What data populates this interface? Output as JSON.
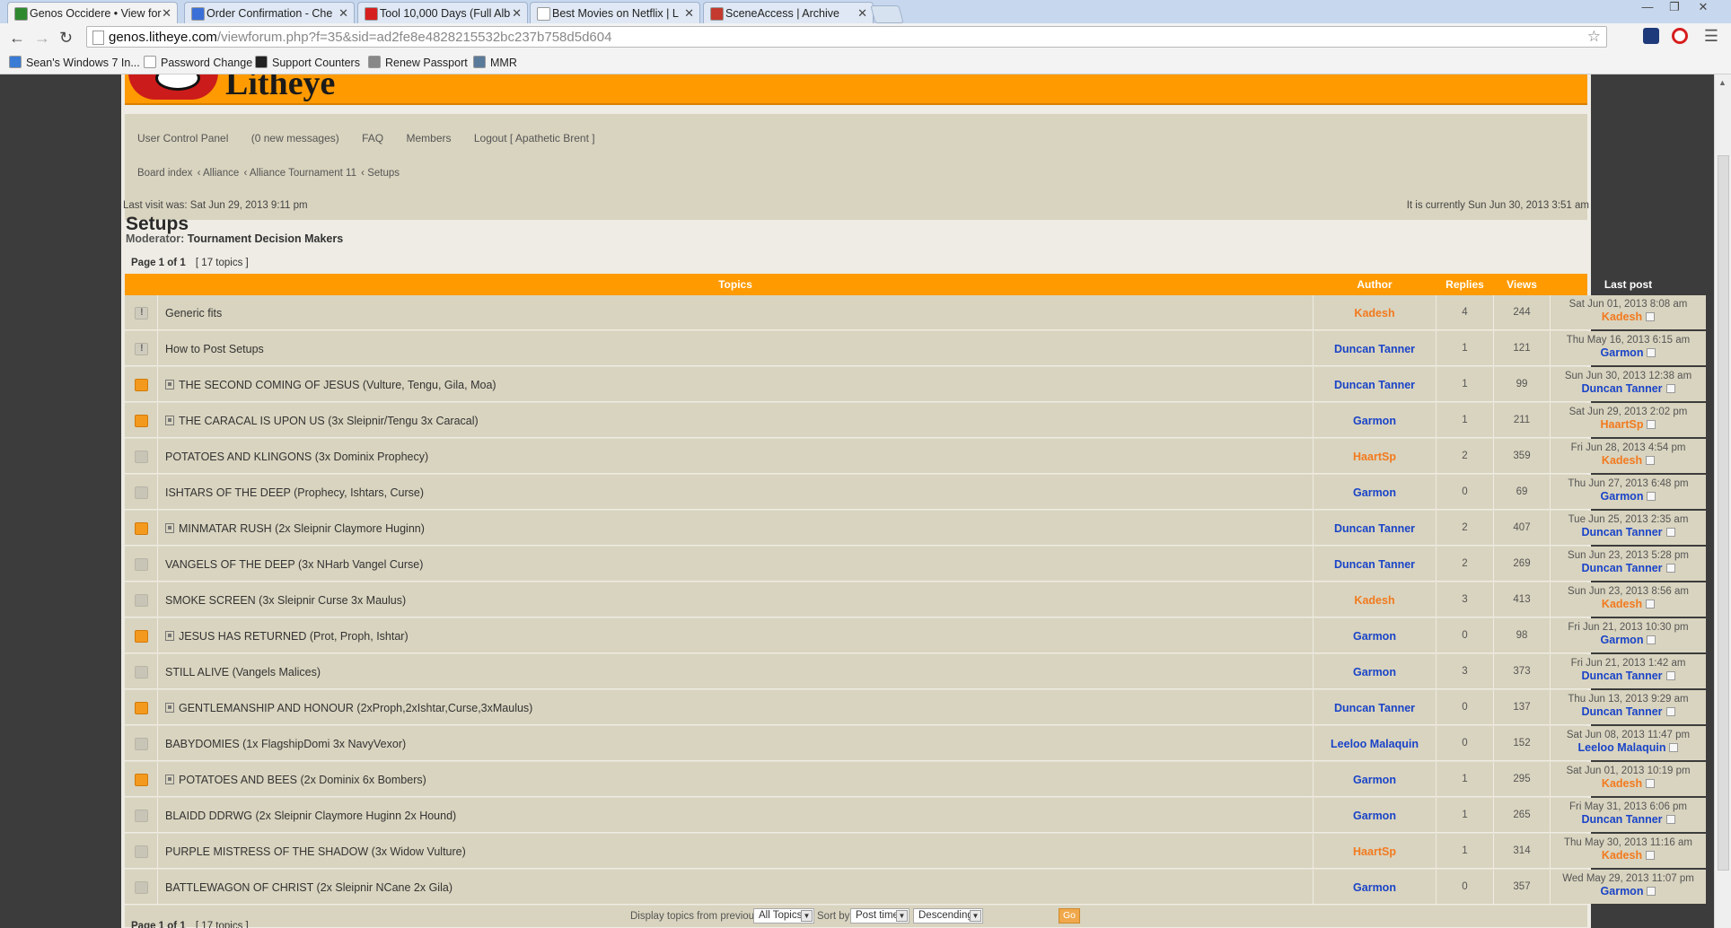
{
  "browser": {
    "tabs": [
      {
        "title": "Genos Occidere • View for",
        "color": "#2f8a2f",
        "active": true
      },
      {
        "title": "Order Confirmation - Che",
        "color": "#3a6fd8",
        "active": false
      },
      {
        "title": "Tool 10,000 Days (Full Alb",
        "color": "#d61f1f",
        "active": false
      },
      {
        "title": "Best Movies on Netflix | L",
        "color": "#ffffff",
        "active": false
      },
      {
        "title": "SceneAccess | Archive",
        "color": "#c43a2e",
        "active": false
      }
    ],
    "url_host": "genos.litheye.com",
    "url_path": "/viewforum.php?f=35&sid=ad2fe8e4828215532bc237b758d5d604",
    "bookmarks": [
      {
        "label": "Sean's Windows 7 In...",
        "color": "#3a7bd5"
      },
      {
        "label": "Password Change",
        "color": "#ffffff"
      },
      {
        "label": "Support Counters",
        "color": "#222222"
      },
      {
        "label": "Renew Passport",
        "color": "#888888"
      },
      {
        "label": "MMR",
        "color": "#5a7a9a"
      }
    ]
  },
  "site": {
    "logo_text": "Litheye",
    "toplinks": [
      "User Control Panel",
      "(0 new messages)",
      "FAQ",
      "Members",
      "Logout [ Apathetic Brent ]"
    ],
    "breadcrumbs": [
      "Board index",
      "Alliance",
      "Alliance Tournament 11",
      "Setups"
    ],
    "last_visit": "Last visit was: Sat Jun 29, 2013 9:11 pm",
    "currently": "It is currently Sun Jun 30, 2013 3:51 am"
  },
  "forum": {
    "title": "Setups",
    "moderator_label": "Moderator:",
    "moderator": "Tournament Decision Makers",
    "page": "Page 1 of 1",
    "topic_count": "[ 17 topics ]",
    "headers": {
      "topics": "Topics",
      "author": "Author",
      "replies": "Replies",
      "views": "Views",
      "last_post": "Last post"
    },
    "topics": [
      {
        "title": "Generic fits",
        "icon": "sticky",
        "posted": false,
        "author": "Kadesh",
        "author_color": "orange",
        "replies": "4",
        "views": "244",
        "last_date": "Sat Jun 01, 2013 8:08 am",
        "last_author": "Kadesh",
        "last_color": "orange"
      },
      {
        "title": "How to Post Setups",
        "icon": "sticky",
        "posted": false,
        "author": "Duncan Tanner",
        "author_color": "blue",
        "replies": "1",
        "views": "121",
        "last_date": "Thu May 16, 2013 6:15 am",
        "last_author": "Garmon",
        "last_color": "blue"
      },
      {
        "title": "THE SECOND COMING OF JESUS (Vulture, Tengu, Gila, Moa)",
        "icon": "hot",
        "posted": true,
        "author": "Duncan Tanner",
        "author_color": "blue",
        "replies": "1",
        "views": "99",
        "last_date": "Sun Jun 30, 2013 12:38 am",
        "last_author": "Duncan Tanner",
        "last_color": "blue"
      },
      {
        "title": "THE CARACAL IS UPON US (3x Sleipnir/Tengu 3x Caracal)",
        "icon": "hot",
        "posted": true,
        "author": "Garmon",
        "author_color": "blue",
        "replies": "1",
        "views": "211",
        "last_date": "Sat Jun 29, 2013 2:02 pm",
        "last_author": "HaartSp",
        "last_color": "orange"
      },
      {
        "title": "POTATOES AND KLINGONS (3x Dominix Prophecy)",
        "icon": "normal",
        "posted": false,
        "author": "HaartSp",
        "author_color": "orange",
        "replies": "2",
        "views": "359",
        "last_date": "Fri Jun 28, 2013 4:54 pm",
        "last_author": "Kadesh",
        "last_color": "orange"
      },
      {
        "title": "ISHTARS OF THE DEEP (Prophecy, Ishtars, Curse)",
        "icon": "normal",
        "posted": false,
        "author": "Garmon",
        "author_color": "blue",
        "replies": "0",
        "views": "69",
        "last_date": "Thu Jun 27, 2013 6:48 pm",
        "last_author": "Garmon",
        "last_color": "blue"
      },
      {
        "title": "MINMATAR RUSH (2x Sleipnir Claymore Huginn)",
        "icon": "hot",
        "posted": true,
        "author": "Duncan Tanner",
        "author_color": "blue",
        "replies": "2",
        "views": "407",
        "last_date": "Tue Jun 25, 2013 2:35 am",
        "last_author": "Duncan Tanner",
        "last_color": "blue"
      },
      {
        "title": "VANGELS OF THE DEEP (3x NHarb Vangel Curse)",
        "icon": "normal",
        "posted": false,
        "author": "Duncan Tanner",
        "author_color": "blue",
        "replies": "2",
        "views": "269",
        "last_date": "Sun Jun 23, 2013 5:28 pm",
        "last_author": "Duncan Tanner",
        "last_color": "blue"
      },
      {
        "title": "SMOKE SCREEN (3x Sleipnir Curse 3x Maulus)",
        "icon": "normal",
        "posted": false,
        "author": "Kadesh",
        "author_color": "orange",
        "replies": "3",
        "views": "413",
        "last_date": "Sun Jun 23, 2013 8:56 am",
        "last_author": "Kadesh",
        "last_color": "orange"
      },
      {
        "title": "JESUS HAS RETURNED (Prot, Proph, Ishtar)",
        "icon": "hot",
        "posted": true,
        "author": "Garmon",
        "author_color": "blue",
        "replies": "0",
        "views": "98",
        "last_date": "Fri Jun 21, 2013 10:30 pm",
        "last_author": "Garmon",
        "last_color": "blue"
      },
      {
        "title": "STILL ALIVE (Vangels Malices)",
        "icon": "normal",
        "posted": false,
        "author": "Garmon",
        "author_color": "blue",
        "replies": "3",
        "views": "373",
        "last_date": "Fri Jun 21, 2013 1:42 am",
        "last_author": "Duncan Tanner",
        "last_color": "blue"
      },
      {
        "title": "GENTLEMANSHIP AND HONOUR (2xProph,2xIshtar,Curse,3xMaulus)",
        "icon": "hot",
        "posted": true,
        "author": "Duncan Tanner",
        "author_color": "blue",
        "replies": "0",
        "views": "137",
        "last_date": "Thu Jun 13, 2013 9:29 am",
        "last_author": "Duncan Tanner",
        "last_color": "blue"
      },
      {
        "title": "BABYDOMIES (1x FlagshipDomi 3x NavyVexor)",
        "icon": "normal",
        "posted": false,
        "author": "Leeloo Malaquin",
        "author_color": "blue",
        "replies": "0",
        "views": "152",
        "last_date": "Sat Jun 08, 2013 11:47 pm",
        "last_author": "Leeloo Malaquin",
        "last_color": "blue"
      },
      {
        "title": "POTATOES AND BEES (2x Dominix 6x Bombers)",
        "icon": "hot",
        "posted": true,
        "author": "Garmon",
        "author_color": "blue",
        "replies": "1",
        "views": "295",
        "last_date": "Sat Jun 01, 2013 10:19 pm",
        "last_author": "Kadesh",
        "last_color": "orange"
      },
      {
        "title": "BLAIDD DDRWG (2x Sleipnir Claymore Huginn 2x Hound)",
        "icon": "normal",
        "posted": false,
        "author": "Garmon",
        "author_color": "blue",
        "replies": "1",
        "views": "265",
        "last_date": "Fri May 31, 2013 6:06 pm",
        "last_author": "Duncan Tanner",
        "last_color": "blue"
      },
      {
        "title": "PURPLE MISTRESS OF THE SHADOW (3x Widow Vulture)",
        "icon": "normal",
        "posted": false,
        "author": "HaartSp",
        "author_color": "orange",
        "replies": "1",
        "views": "314",
        "last_date": "Thu May 30, 2013 11:16 am",
        "last_author": "Kadesh",
        "last_color": "orange"
      },
      {
        "title": "BATTLEWAGON OF CHRIST (2x Sleipnir NCane 2x Gila)",
        "icon": "normal",
        "posted": false,
        "author": "Garmon",
        "author_color": "blue",
        "replies": "0",
        "views": "357",
        "last_date": "Wed May 29, 2013 11:07 pm",
        "last_author": "Garmon",
        "last_color": "blue"
      }
    ],
    "display": {
      "label": "Display topics from previous:",
      "filter": "All Topics",
      "sort_label": "Sort by",
      "sort": "Post time",
      "order": "Descending",
      "go": "Go"
    }
  }
}
